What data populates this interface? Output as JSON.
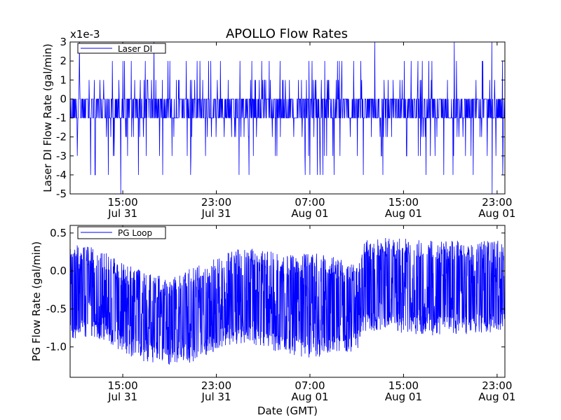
{
  "figure": {
    "title": "APOLLO Flow Rates",
    "xlabel": "Date (GMT)"
  },
  "chart_data": [
    {
      "type": "line",
      "ylabel": "Laser DI Flow Rate (gal/min)",
      "offset_text": "x1e-3",
      "ylim": [
        -5,
        3
      ],
      "yticks": [
        -5,
        -4,
        -3,
        -2,
        -1,
        0,
        1,
        2,
        3
      ],
      "ytick_labels": [
        "-5",
        "-4",
        "-3",
        "-2",
        "-1",
        "0",
        "1",
        "2",
        "3"
      ],
      "x_range": [
        "2014-07-31T10:30",
        "2014-08-01T23:40"
      ],
      "xticks": [
        {
          "at": "2014-07-31T15:00",
          "time": "15:00",
          "date": "Jul 31"
        },
        {
          "at": "2014-07-31T23:00",
          "time": "23:00",
          "date": "Jul 31"
        },
        {
          "at": "2014-08-01T07:00",
          "time": "07:00",
          "date": "Aug 01"
        },
        {
          "at": "2014-08-01T15:00",
          "time": "15:00",
          "date": "Aug 01"
        },
        {
          "at": "2014-08-01T23:00",
          "time": "23:00",
          "date": "Aug 01"
        }
      ],
      "legend": {
        "position": "upper-left"
      },
      "series": [
        {
          "name": "Laser DI",
          "color": "#0000ff",
          "description": "quantized noisy signal; dominant levels -1..0, frequent spikes to 1, 2 and -2, -3, -4, rare excursions to 3 and -5",
          "levels": [
            -5,
            -4,
            -3,
            -2,
            -1,
            0,
            1,
            2,
            3
          ],
          "x": [
            "2014-07-31T10:30",
            "2014-07-31T15:00",
            "2014-07-31T19:00",
            "2014-07-31T23:00",
            "2014-08-01T03:00",
            "2014-08-01T07:00",
            "2014-08-01T11:00",
            "2014-08-01T15:00",
            "2014-08-01T19:00",
            "2014-08-01T23:40"
          ],
          "y": [
            0,
            -1,
            0,
            -1,
            0,
            -1,
            0,
            -1,
            0,
            -1
          ]
        }
      ]
    },
    {
      "type": "line",
      "ylabel": "PG Flow Rate (gal/min)",
      "ylim": [
        -1.4,
        0.6
      ],
      "yticks": [
        -1.0,
        -0.5,
        0.0,
        0.5
      ],
      "ytick_labels": [
        "-1.0",
        "-0.5",
        "0.0",
        "0.5"
      ],
      "x_range": [
        "2014-07-31T10:30",
        "2014-08-01T23:40"
      ],
      "xticks": [
        {
          "at": "2014-07-31T15:00",
          "time": "15:00",
          "date": "Jul 31"
        },
        {
          "at": "2014-07-31T23:00",
          "time": "23:00",
          "date": "Jul 31"
        },
        {
          "at": "2014-08-01T07:00",
          "time": "07:00",
          "date": "Aug 01"
        },
        {
          "at": "2014-08-01T15:00",
          "time": "15:00",
          "date": "Aug 01"
        },
        {
          "at": "2014-08-01T23:00",
          "time": "23:00",
          "date": "Aug 01"
        }
      ],
      "legend": {
        "position": "upper-left"
      },
      "series": [
        {
          "name": "PG Loop",
          "color": "#0000ff",
          "description": "dense noisy signal; envelope upper/lower bounds over time",
          "x": [
            "2014-07-31T10:30",
            "2014-07-31T13:00",
            "2014-07-31T15:00",
            "2014-07-31T17:00",
            "2014-07-31T19:00",
            "2014-07-31T21:00",
            "2014-07-31T23:00",
            "2014-08-01T01:00",
            "2014-08-01T03:00",
            "2014-08-01T05:00",
            "2014-08-01T07:00",
            "2014-08-01T09:00",
            "2014-08-01T11:00",
            "2014-08-01T11:40",
            "2014-08-01T14:00",
            "2014-08-01T17:00",
            "2014-08-01T20:00",
            "2014-08-01T23:40"
          ],
          "upper": [
            0.35,
            0.3,
            0.1,
            0.0,
            -0.1,
            0.05,
            0.2,
            0.3,
            0.3,
            0.2,
            0.25,
            0.2,
            0.1,
            0.4,
            0.45,
            0.4,
            0.4,
            0.4
          ],
          "lower": [
            -0.9,
            -0.9,
            -1.1,
            -1.2,
            -1.25,
            -1.2,
            -1.05,
            -0.95,
            -1.0,
            -1.1,
            -1.15,
            -1.1,
            -1.05,
            -0.8,
            -0.8,
            -0.85,
            -0.85,
            -0.8
          ]
        }
      ]
    }
  ]
}
